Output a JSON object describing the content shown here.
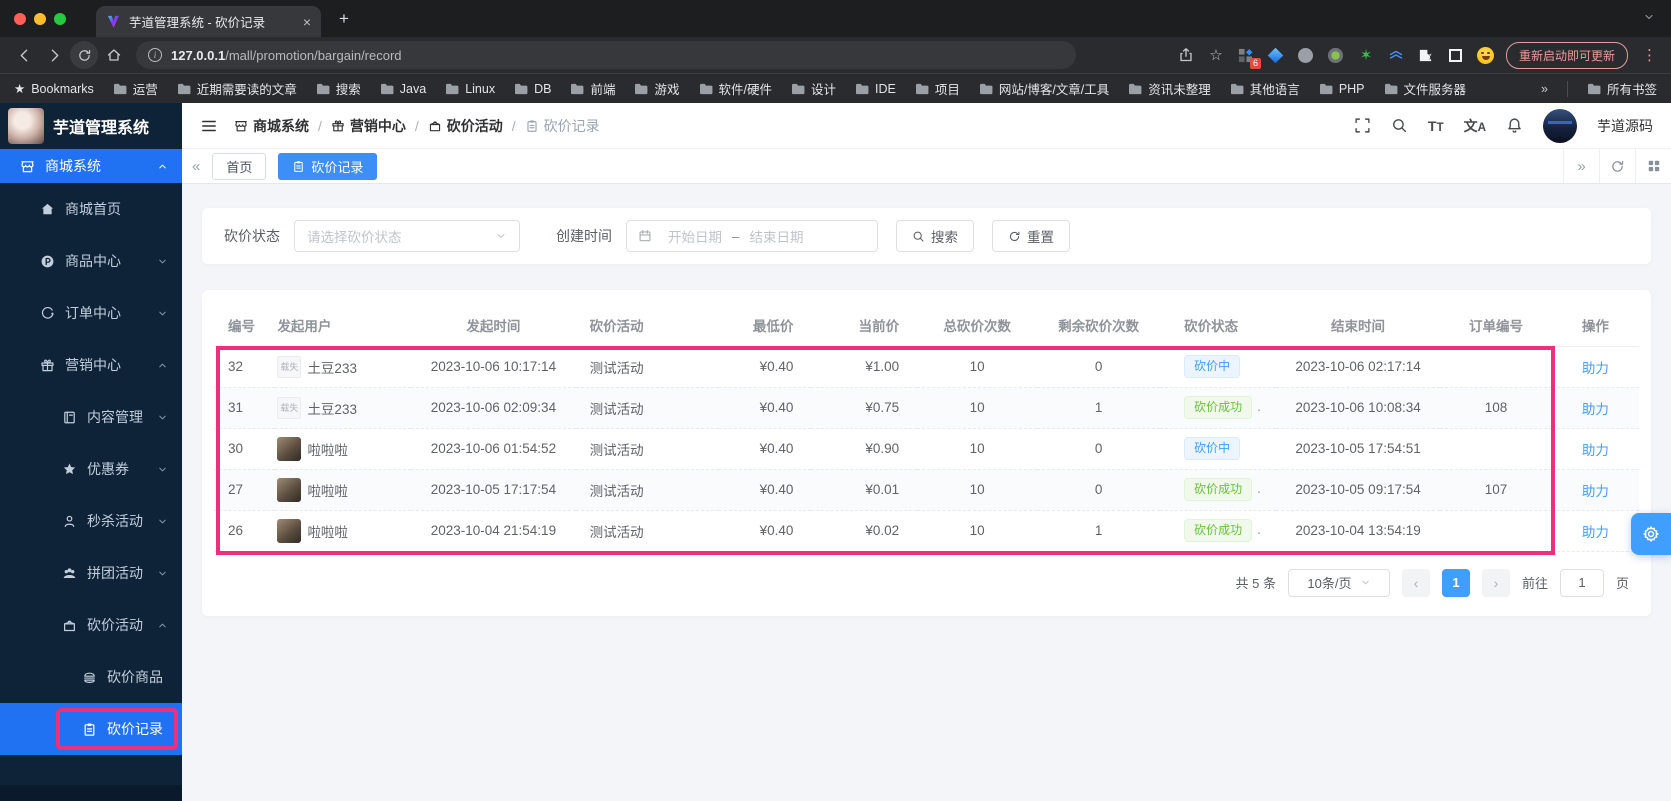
{
  "colors": {
    "accent": "#409eff",
    "highlight_pink": "#ee2f7b",
    "sidebar_bg": "#0e2338",
    "active_menu_blue": "#2172f2",
    "status_processing": "#409eff",
    "status_success": "#67c23a"
  },
  "browser": {
    "tab": {
      "title": "芋道管理系统 - 砍价记录",
      "close_glyph": "×"
    },
    "new_tab_glyph": "+",
    "url_host": "127.0.0.1",
    "url_path": "/mall/promotion/bargain/record",
    "extension_badge": "6",
    "update_button": "重新启动即可更新",
    "menu_glyph": "⋮",
    "bookmarks_label": "Bookmarks",
    "bookmarks": [
      "运营",
      "近期需要读的文章",
      "搜索",
      "Java",
      "Linux",
      "DB",
      "前端",
      "游戏",
      "软件/硬件",
      "设计",
      "IDE",
      "项目",
      "网站/博客/文章/工具",
      "资讯未整理",
      "其他语言",
      "PHP",
      "文件服务器"
    ],
    "bookmarks_overflow": "»",
    "all_bookmarks_label": "所有书签"
  },
  "header": {
    "logo_title": "芋道管理系统",
    "breadcrumb": [
      "商城系统",
      "营销中心",
      "砍价活动",
      "砍价记录"
    ],
    "breadcrumb_separator": "/",
    "username": "芋道源码"
  },
  "tabbar": {
    "back_glyph": "«",
    "forward_glyph": "»",
    "tabs": [
      {
        "label": "首页"
      },
      {
        "label": "砍价记录"
      }
    ]
  },
  "sidebar": {
    "items": [
      {
        "label": "商城系统"
      },
      {
        "label": "商城首页"
      },
      {
        "label": "商品中心"
      },
      {
        "label": "订单中心"
      },
      {
        "label": "营销中心"
      },
      {
        "label": "内容管理"
      },
      {
        "label": "优惠券"
      },
      {
        "label": "秒杀活动"
      },
      {
        "label": "拼团活动"
      },
      {
        "label": "砍价活动"
      },
      {
        "label": "砍价商品"
      },
      {
        "label": "砍价记录"
      }
    ]
  },
  "filters": {
    "status_label": "砍价状态",
    "status_placeholder": "请选择砍价状态",
    "time_label": "创建时间",
    "start_placeholder": "开始日期",
    "range_separator": "–",
    "end_placeholder": "结束日期",
    "search_button": "搜索",
    "reset_button": "重置"
  },
  "table": {
    "columns": [
      "编号",
      "发起用户",
      "发起时间",
      "砍价活动",
      "最低价",
      "当前价",
      "总砍价次数",
      "剩余砍价次数",
      "砍价状态",
      "结束时间",
      "订单编号",
      "操作"
    ],
    "broken_avatar_text": "载失",
    "status_dot": ".",
    "rows": [
      {
        "id": "32",
        "user": "土豆233",
        "start": "2023-10-06 10:17:14",
        "activity": "测试活动",
        "floor_price": "¥0.40",
        "current_price": "¥1.00",
        "total_times": "10",
        "remain_times": "0",
        "status": "砍价中",
        "end": "2023-10-06 02:17:14",
        "order": "",
        "action": "助力"
      },
      {
        "id": "31",
        "user": "土豆233",
        "start": "2023-10-06 02:09:34",
        "activity": "测试活动",
        "floor_price": "¥0.40",
        "current_price": "¥0.75",
        "total_times": "10",
        "remain_times": "1",
        "status": "砍价成功",
        "end": "2023-10-06 10:08:34",
        "order": "108",
        "action": "助力"
      },
      {
        "id": "30",
        "user": "啦啦啦",
        "start": "2023-10-06 01:54:52",
        "activity": "测试活动",
        "floor_price": "¥0.40",
        "current_price": "¥0.90",
        "total_times": "10",
        "remain_times": "0",
        "status": "砍价中",
        "end": "2023-10-05 17:54:51",
        "order": "",
        "action": "助力"
      },
      {
        "id": "27",
        "user": "啦啦啦",
        "start": "2023-10-05 17:17:54",
        "activity": "测试活动",
        "floor_price": "¥0.40",
        "current_price": "¥0.01",
        "total_times": "10",
        "remain_times": "0",
        "status": "砍价成功",
        "end": "2023-10-05 09:17:54",
        "order": "107",
        "action": "助力"
      },
      {
        "id": "26",
        "user": "啦啦啦",
        "start": "2023-10-04 21:54:19",
        "activity": "测试活动",
        "floor_price": "¥0.40",
        "current_price": "¥0.02",
        "total_times": "10",
        "remain_times": "1",
        "status": "砍价成功",
        "end": "2023-10-04 13:54:19",
        "order": "",
        "action": "助力"
      }
    ]
  },
  "pagination": {
    "total": "共 5 条",
    "page_size": "10条/页",
    "prev_glyph": "‹",
    "page": "1",
    "next_glyph": "›",
    "goto_label": "前往",
    "goto_value": "1",
    "page_unit": "页"
  }
}
